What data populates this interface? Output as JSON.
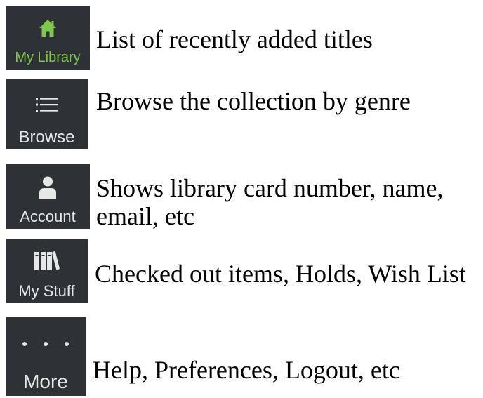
{
  "tabs": [
    {
      "id": "library",
      "label": "My Library",
      "icon": "home-icon",
      "label_color": "#7ec84a",
      "icon_color": "#7ec84a",
      "selected": true,
      "description_lines": [
        "List of recently added titles"
      ]
    },
    {
      "id": "browse",
      "label": "Browse",
      "icon": "list-icon",
      "label_color": "#e6e6e6",
      "icon_color": "#e6e6e6",
      "selected": false,
      "description_lines": [
        "Browse the collection by genre"
      ]
    },
    {
      "id": "account",
      "label": "Account",
      "icon": "person-icon",
      "label_color": "#e6e6e6",
      "icon_color": "#e6e6e6",
      "selected": false,
      "description_lines": [
        "Shows library card number, name,",
        "email, etc"
      ]
    },
    {
      "id": "stuff",
      "label": "My Stuff",
      "icon": "books-icon",
      "label_color": "#e6e6e6",
      "icon_color": "#e6e6e6",
      "selected": false,
      "description_lines": [
        "Checked out items, Holds, Wish List"
      ]
    },
    {
      "id": "more",
      "label": "More",
      "icon": "ellipsis-icon",
      "label_color": "#e6e6e6",
      "icon_color": "#e6e6e6",
      "selected": false,
      "description_lines": [
        "Help, Preferences, Logout, etc"
      ]
    }
  ],
  "colors": {
    "tab_background": "#2e3135",
    "accent_green": "#7ec84a",
    "icon_inactive": "#e6e6e6",
    "description_text": "#000000"
  }
}
